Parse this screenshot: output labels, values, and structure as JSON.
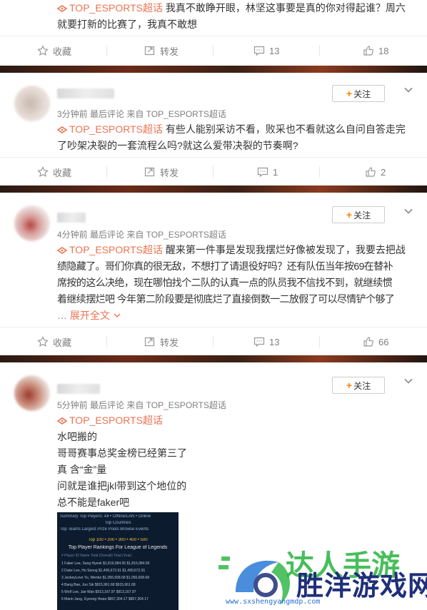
{
  "posts": [
    {
      "topic": "TOP_ESPORTS超话",
      "lines": [
        "我真不敢睁开眼，林坚这事要是真的你对得起谁？周六",
        "就要打新的比赛了，我真不敢想"
      ],
      "actions": {
        "fav": "收藏",
        "repost": "转发",
        "comments": "13",
        "likes": "18"
      }
    },
    {
      "follow": "关注",
      "meta": "3分钟前 最后评论 来自 TOP_ESPORTS超话",
      "topic": "TOP_ESPORTS超话",
      "lines": [
        "有些人能别采访不看，败采也不看就这么自问自答走完",
        "了吵架决裂的一套流程么吗?就这么爱带决裂的节奏啊?"
      ],
      "actions": {
        "fav": "收藏",
        "repost": "转发",
        "comments": "1",
        "likes": "2"
      }
    },
    {
      "follow": "关注",
      "meta": "4分钟前 最后评论 来自 TOP_ESPORTS超话",
      "topic": "TOP_ESPORTS超话",
      "lines": [
        "醒来第一件事是发现我摆烂好像被发现了，我要去把战",
        "绩隐藏了。哥们你真的很无敌，不想打了请退役好吗？还有队伍当年按69在替补",
        "席按的这么决绝，现在哪怕找个二队的认真一点的队员我不信找不到，就继续惯",
        "着继续摆烂吧 今年第二阶段要是彻底烂了直接倒数一二放假了可以尽情铲个够了"
      ],
      "expand": "展开全文",
      "actions": {
        "fav": "收藏",
        "repost": "转发",
        "comments": "13",
        "likes": "66"
      }
    },
    {
      "follow": "关注",
      "meta": "5分钟前 最后评论 来自 TOP_ESPORTS超话",
      "topic": "TOP_ESPORTS超话",
      "lines": [
        "水吧搬的",
        "哥哥赛事总奖金榜已经第三了",
        "真 含“金”量",
        "问就是谁把jkl带到这个地位的",
        "总不能是faker吧"
      ]
    }
  ],
  "screenshot": {
    "nav": "Summary   Top Players: All • Offline/LAN • Online",
    "sub": "Top Countries",
    "tabs": "Top Teams   Largest Prize Pools   Browse Events",
    "pages": "Top 100 • 200 • 300 • 400 • 500",
    "title": "Top Player Rankings For League of Legends",
    "header": "#    Player ID      Name             Total (Overall)   Total (Year)",
    "rows": [
      "1  Faker      Lee, Sang Hyeok    $1,816,084.56   $1,816,084.56",
      "2  Duke       Lee, Ho Seong      $1,490,672.91   $1,490,672.91",
      "3  JackeyLove  Yu, Wenbo         $1,056,658.68   $1,056,658.68",
      "4  Bang       Bae, Jun Sik       $915,961.68     $915,961.68",
      "5  Wolf       Lee, Jae Wan       $913,167.97     $913,167.97",
      "6  Marin      Jang, Gyeong Hwan  $857,304.17     $857,304.17"
    ]
  },
  "watermark": {
    "green_text": "达人手游",
    "brand": "胜洋游戏网",
    "url": "www.sxshengyangmdp.com"
  },
  "colors": {
    "accent": "#eb7350",
    "follow_plus": "#ff8200",
    "brand_blue": "#1f2f7a",
    "brand_green": "#35b84a"
  }
}
